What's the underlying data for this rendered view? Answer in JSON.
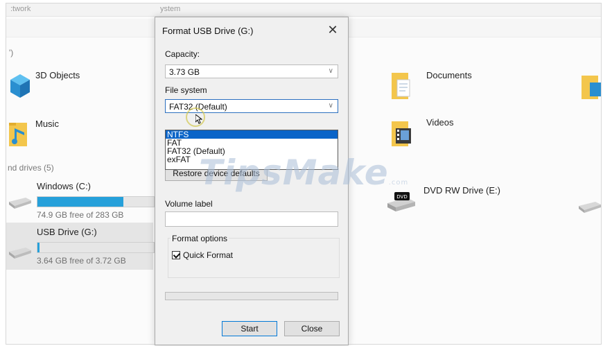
{
  "explorer": {
    "top_left": ":twork",
    "top_mid": "ystem",
    "folders_header_fragment": "')",
    "folders": [
      {
        "label": "3D Objects",
        "icon": "3d-objects-icon"
      },
      {
        "label": "Documents",
        "icon": "documents-folder-icon"
      },
      {
        "label": "Music",
        "icon": "music-folder-icon"
      },
      {
        "label": "Videos",
        "icon": "videos-folder-icon"
      }
    ],
    "drives_header": "nd drives (5)",
    "drives": [
      {
        "name": "Windows (C:)",
        "free": "74.9 GB free of 283 GB",
        "used_fraction": 0.74
      },
      {
        "name": "USB Drive (G:)",
        "free": "3.64 GB free of 3.72 GB",
        "used_fraction": 0.02
      },
      {
        "name": "DVD RW Drive (E:)"
      }
    ],
    "accent": "#26a0da"
  },
  "dialog": {
    "title": "Format USB Drive (G:)",
    "close_glyph": "✕",
    "capacity_label": "Capacity:",
    "capacity_value": "3.73 GB",
    "filesystem_label": "File system",
    "filesystem_value": "FAT32 (Default)",
    "filesystem_options": [
      "NTFS",
      "FAT",
      "FAT32 (Default)",
      "exFAT"
    ],
    "highlighted_option": "NTFS",
    "restore_button": "Restore device defaults",
    "volume_label": "Volume label",
    "volume_value": "",
    "format_options_label": "Format options",
    "quick_format_label": "Quick Format",
    "quick_format_checked": true,
    "start_button": "Start",
    "close_button": "Close",
    "highlight_color": "#0a64c8"
  },
  "watermark": {
    "text": "TipsMake",
    "suffix": ".com"
  }
}
